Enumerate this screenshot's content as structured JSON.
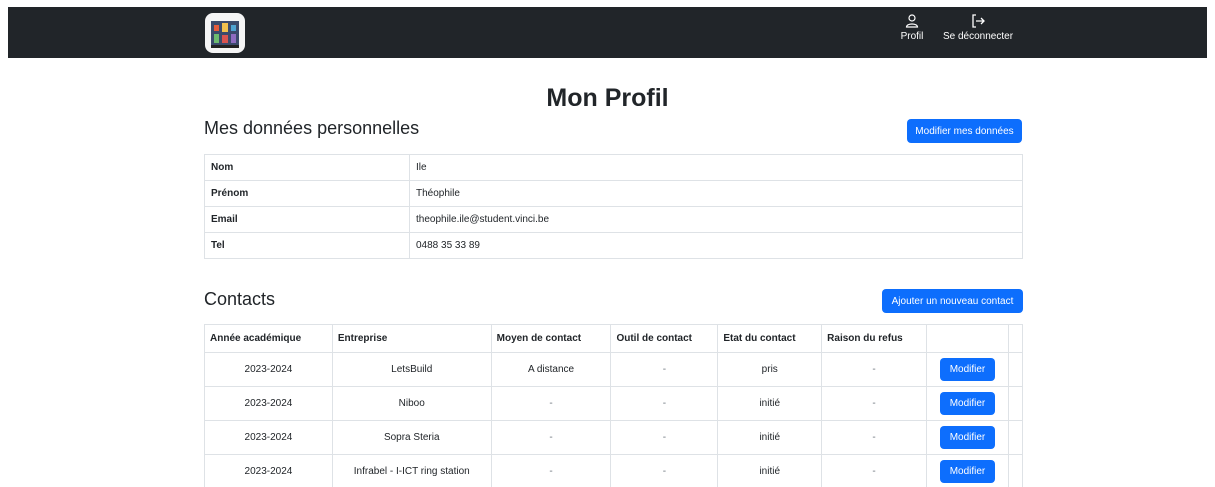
{
  "nav": {
    "profil_label": "Profil",
    "logout_label": "Se déconnecter"
  },
  "page": {
    "title": "Mon Profil"
  },
  "personal": {
    "title": "Mes données personnelles",
    "edit_button": "Modifier mes données",
    "rows": [
      {
        "key": "Nom",
        "value": "Ile"
      },
      {
        "key": "Prénom",
        "value": "Théophile"
      },
      {
        "key": "Email",
        "value": "theophile.ile@student.vinci.be"
      },
      {
        "key": "Tel",
        "value": "0488 35 33 89"
      }
    ]
  },
  "contacts": {
    "title": "Contacts",
    "add_button": "Ajouter un nouveau contact",
    "headers": [
      "Année académique",
      "Entreprise",
      "Moyen de contact",
      "Outil de contact",
      "Etat du contact",
      "Raison du refus",
      ""
    ],
    "rows": [
      {
        "year": "2023-2024",
        "company": "LetsBuild",
        "means": "A distance",
        "tool": "-",
        "state": "pris",
        "reason": "-",
        "action": "Modifier"
      },
      {
        "year": "2023-2024",
        "company": "Niboo",
        "means": "-",
        "tool": "-",
        "state": "initié",
        "reason": "-",
        "action": "Modifier"
      },
      {
        "year": "2023-2024",
        "company": "Sopra Steria",
        "means": "-",
        "tool": "-",
        "state": "initié",
        "reason": "-",
        "action": "Modifier"
      },
      {
        "year": "2023-2024",
        "company": "Infrabel - I-ICT ring station",
        "means": "-",
        "tool": "-",
        "state": "initié",
        "reason": "-",
        "action": "Modifier"
      }
    ]
  },
  "colors": {
    "navbar": "#212529",
    "primary": "#0d6efd",
    "border": "#dee2e6"
  }
}
